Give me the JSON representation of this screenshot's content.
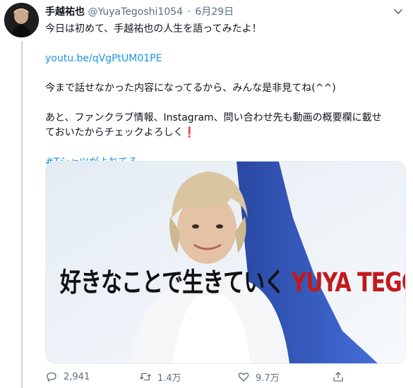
{
  "tweet": {
    "display_name": "手越祐也",
    "handle": "@YuyaTegoshi1054",
    "separator": "·",
    "date": "6月29日",
    "line1": "今日は初めて、手越祐也の人生を語ってみたよ！",
    "link": "youtu.be/qVgPtUM01PE",
    "line2": "今まで話せなかった内容になってるから、みんな是非見てね(^^)",
    "line3a": "あと、ファンクラブ情報、Instagram、問い合わせ先も動画の概要欄に載せ",
    "line3b": "ておいたからチェックよろしく",
    "exclaim": "❗",
    "hashtag": "#Tシャツがよれてる"
  },
  "media": {
    "banner_jp": "好きなことで生きていく",
    "banner_en": "YUYA TEGOSHI"
  },
  "actions": {
    "reply_count": "2,941",
    "retweet_count": "1.4万",
    "like_count": "9.7万"
  },
  "icons": {
    "reply": "reply-icon",
    "retweet": "retweet-icon",
    "like": "heart-icon",
    "share": "share-icon",
    "more": "chevron-down-icon"
  },
  "colors": {
    "link": "#1b95e0",
    "secondary": "#5b7083",
    "banner_red": "#c21a1a"
  }
}
